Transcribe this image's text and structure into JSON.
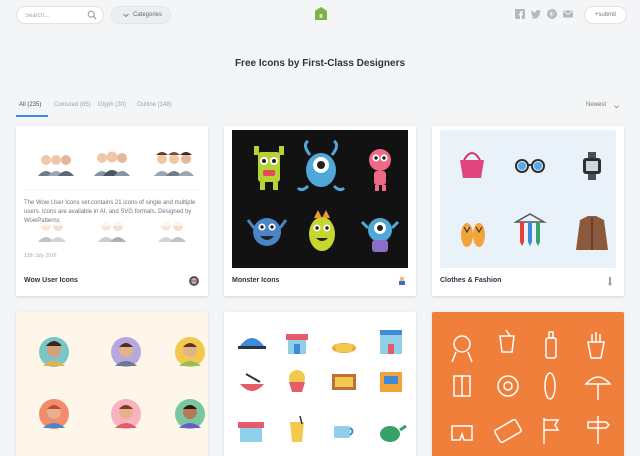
{
  "header": {
    "search_placeholder": "Search...",
    "categories_label": "Categories",
    "submit_label": "+submit"
  },
  "page_title": "Free Icons by First-Class Designers",
  "filters": [
    {
      "label": "All (235)"
    },
    {
      "label": "Coloured (85)"
    },
    {
      "label": "Glyph (30)"
    },
    {
      "label": "Outline (148)"
    }
  ],
  "sort_label": "Newest",
  "cards": [
    {
      "title": "Wow User Icons",
      "description": "The Wow User Icons set contains 21 icons of single and multiple users. Icons are available in AI, and SVG formats. Designed by WowPatterns",
      "date": "13th July 2016"
    },
    {
      "title": "Monster Icons"
    },
    {
      "title": "Clothes & Fashion"
    }
  ],
  "colors": {
    "accent": "#3d8bd9",
    "monster_bg": "#121212",
    "clothes_bg": "#e8f2f8",
    "avatars_bg": "#fdf6e9",
    "orange_bg": "#ef7f3a"
  }
}
